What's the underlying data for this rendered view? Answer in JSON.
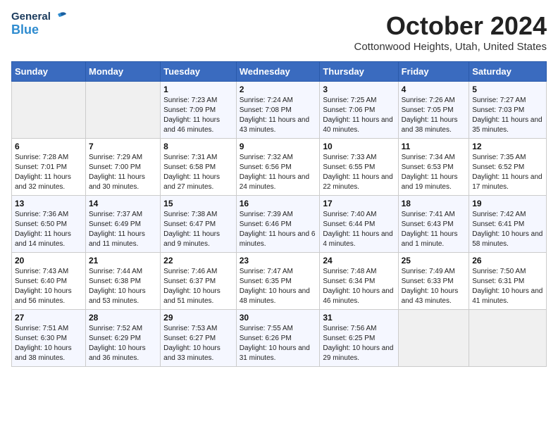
{
  "header": {
    "logo_general": "General",
    "logo_blue": "Blue",
    "month_title": "October 2024",
    "location": "Cottonwood Heights, Utah, United States"
  },
  "days_of_week": [
    "Sunday",
    "Monday",
    "Tuesday",
    "Wednesday",
    "Thursday",
    "Friday",
    "Saturday"
  ],
  "weeks": [
    [
      {
        "day": "",
        "empty": true
      },
      {
        "day": "",
        "empty": true
      },
      {
        "day": "1",
        "sunrise": "7:23 AM",
        "sunset": "7:09 PM",
        "daylight": "11 hours and 46 minutes."
      },
      {
        "day": "2",
        "sunrise": "7:24 AM",
        "sunset": "7:08 PM",
        "daylight": "11 hours and 43 minutes."
      },
      {
        "day": "3",
        "sunrise": "7:25 AM",
        "sunset": "7:06 PM",
        "daylight": "11 hours and 40 minutes."
      },
      {
        "day": "4",
        "sunrise": "7:26 AM",
        "sunset": "7:05 PM",
        "daylight": "11 hours and 38 minutes."
      },
      {
        "day": "5",
        "sunrise": "7:27 AM",
        "sunset": "7:03 PM",
        "daylight": "11 hours and 35 minutes."
      }
    ],
    [
      {
        "day": "6",
        "sunrise": "7:28 AM",
        "sunset": "7:01 PM",
        "daylight": "11 hours and 32 minutes."
      },
      {
        "day": "7",
        "sunrise": "7:29 AM",
        "sunset": "7:00 PM",
        "daylight": "11 hours and 30 minutes."
      },
      {
        "day": "8",
        "sunrise": "7:31 AM",
        "sunset": "6:58 PM",
        "daylight": "11 hours and 27 minutes."
      },
      {
        "day": "9",
        "sunrise": "7:32 AM",
        "sunset": "6:56 PM",
        "daylight": "11 hours and 24 minutes."
      },
      {
        "day": "10",
        "sunrise": "7:33 AM",
        "sunset": "6:55 PM",
        "daylight": "11 hours and 22 minutes."
      },
      {
        "day": "11",
        "sunrise": "7:34 AM",
        "sunset": "6:53 PM",
        "daylight": "11 hours and 19 minutes."
      },
      {
        "day": "12",
        "sunrise": "7:35 AM",
        "sunset": "6:52 PM",
        "daylight": "11 hours and 17 minutes."
      }
    ],
    [
      {
        "day": "13",
        "sunrise": "7:36 AM",
        "sunset": "6:50 PM",
        "daylight": "11 hours and 14 minutes."
      },
      {
        "day": "14",
        "sunrise": "7:37 AM",
        "sunset": "6:49 PM",
        "daylight": "11 hours and 11 minutes."
      },
      {
        "day": "15",
        "sunrise": "7:38 AM",
        "sunset": "6:47 PM",
        "daylight": "11 hours and 9 minutes."
      },
      {
        "day": "16",
        "sunrise": "7:39 AM",
        "sunset": "6:46 PM",
        "daylight": "11 hours and 6 minutes."
      },
      {
        "day": "17",
        "sunrise": "7:40 AM",
        "sunset": "6:44 PM",
        "daylight": "11 hours and 4 minutes."
      },
      {
        "day": "18",
        "sunrise": "7:41 AM",
        "sunset": "6:43 PM",
        "daylight": "11 hours and 1 minute."
      },
      {
        "day": "19",
        "sunrise": "7:42 AM",
        "sunset": "6:41 PM",
        "daylight": "10 hours and 58 minutes."
      }
    ],
    [
      {
        "day": "20",
        "sunrise": "7:43 AM",
        "sunset": "6:40 PM",
        "daylight": "10 hours and 56 minutes."
      },
      {
        "day": "21",
        "sunrise": "7:44 AM",
        "sunset": "6:38 PM",
        "daylight": "10 hours and 53 minutes."
      },
      {
        "day": "22",
        "sunrise": "7:46 AM",
        "sunset": "6:37 PM",
        "daylight": "10 hours and 51 minutes."
      },
      {
        "day": "23",
        "sunrise": "7:47 AM",
        "sunset": "6:35 PM",
        "daylight": "10 hours and 48 minutes."
      },
      {
        "day": "24",
        "sunrise": "7:48 AM",
        "sunset": "6:34 PM",
        "daylight": "10 hours and 46 minutes."
      },
      {
        "day": "25",
        "sunrise": "7:49 AM",
        "sunset": "6:33 PM",
        "daylight": "10 hours and 43 minutes."
      },
      {
        "day": "26",
        "sunrise": "7:50 AM",
        "sunset": "6:31 PM",
        "daylight": "10 hours and 41 minutes."
      }
    ],
    [
      {
        "day": "27",
        "sunrise": "7:51 AM",
        "sunset": "6:30 PM",
        "daylight": "10 hours and 38 minutes."
      },
      {
        "day": "28",
        "sunrise": "7:52 AM",
        "sunset": "6:29 PM",
        "daylight": "10 hours and 36 minutes."
      },
      {
        "day": "29",
        "sunrise": "7:53 AM",
        "sunset": "6:27 PM",
        "daylight": "10 hours and 33 minutes."
      },
      {
        "day": "30",
        "sunrise": "7:55 AM",
        "sunset": "6:26 PM",
        "daylight": "10 hours and 31 minutes."
      },
      {
        "day": "31",
        "sunrise": "7:56 AM",
        "sunset": "6:25 PM",
        "daylight": "10 hours and 29 minutes."
      },
      {
        "day": "",
        "empty": true
      },
      {
        "day": "",
        "empty": true
      }
    ]
  ]
}
